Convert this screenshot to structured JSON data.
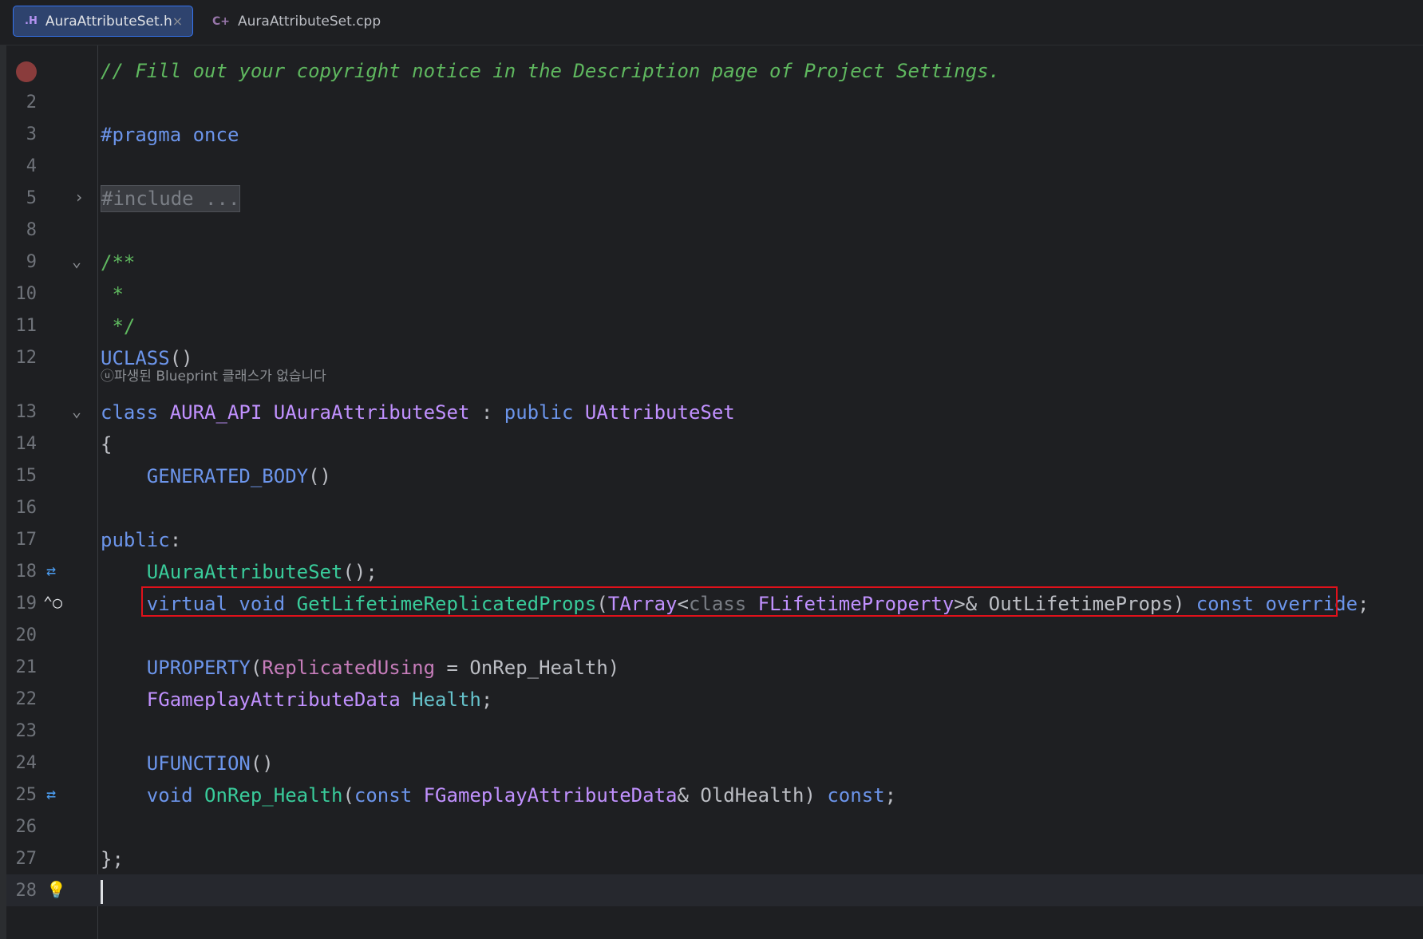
{
  "tabs": [
    {
      "icon": ".H",
      "label": "AuraAttributeSet.h",
      "close": "×"
    },
    {
      "icon": "C+",
      "label": "AuraAttributeSet.cpp"
    }
  ],
  "lines": [
    {
      "n": "",
      "tokens": [
        [
          "cm",
          "// Fill out your copyright notice in the Description page of Project Settings."
        ]
      ]
    },
    {
      "n": "2",
      "tokens": []
    },
    {
      "n": "3",
      "tokens": [
        [
          "kw",
          "#pragma once"
        ]
      ]
    },
    {
      "n": "4",
      "tokens": []
    },
    {
      "n": "5",
      "tokens": [
        [
          "folded",
          "#include ..."
        ]
      ]
    },
    {
      "n": "8",
      "tokens": []
    },
    {
      "n": "9",
      "tokens": [
        [
          "doc",
          "/**"
        ]
      ]
    },
    {
      "n": "10",
      "tokens": [
        [
          "doc",
          " *"
        ]
      ]
    },
    {
      "n": "11",
      "tokens": [
        [
          "doc",
          " */"
        ]
      ]
    },
    {
      "n": "12",
      "tokens": [
        [
          "mac",
          "UCLASS"
        ],
        [
          "plain",
          "()"
        ]
      ]
    },
    {
      "n": "13",
      "tokens": [
        [
          "kw",
          "class "
        ],
        [
          "typ",
          "AURA_API "
        ],
        [
          "typ",
          "UAuraAttributeSet"
        ],
        [
          "plain",
          " : "
        ],
        [
          "kw",
          "public "
        ],
        [
          "typ",
          "UAttributeSet"
        ]
      ]
    },
    {
      "n": "14",
      "tokens": [
        [
          "plain",
          "{"
        ]
      ]
    },
    {
      "n": "15",
      "tokens": [
        [
          "plain",
          "    "
        ],
        [
          "mac",
          "GENERATED_BODY"
        ],
        [
          "plain",
          "()"
        ]
      ]
    },
    {
      "n": "16",
      "tokens": []
    },
    {
      "n": "17",
      "tokens": [
        [
          "kw",
          "public"
        ],
        [
          "plain",
          ":"
        ]
      ]
    },
    {
      "n": "18",
      "tokens": [
        [
          "plain",
          "    "
        ],
        [
          "fn",
          "UAuraAttributeSet"
        ],
        [
          "plain",
          "();"
        ]
      ]
    },
    {
      "n": "19",
      "tokens": [
        [
          "plain",
          "    "
        ],
        [
          "kw",
          "virtual "
        ],
        [
          "kw",
          "void "
        ],
        [
          "fn",
          "GetLifetimeReplicatedProps"
        ],
        [
          "plain",
          "("
        ],
        [
          "typ",
          "TArray"
        ],
        [
          "plain",
          "<"
        ],
        [
          "gray",
          "class "
        ],
        [
          "typ",
          "FLifetimeProperty"
        ],
        [
          "plain",
          ">& "
        ],
        [
          "plain",
          "OutLifetimeProps"
        ],
        [
          "plain",
          ") "
        ],
        [
          "kw",
          "const "
        ],
        [
          "kw",
          "override"
        ],
        [
          "plain",
          ";"
        ]
      ]
    },
    {
      "n": "20",
      "tokens": []
    },
    {
      "n": "21",
      "tokens": [
        [
          "plain",
          "    "
        ],
        [
          "mac",
          "UPROPERTY"
        ],
        [
          "plain",
          "("
        ],
        [
          "ann",
          "ReplicatedUsing"
        ],
        [
          "plain",
          " = OnRep_Health)"
        ]
      ]
    },
    {
      "n": "22",
      "tokens": [
        [
          "plain",
          "    "
        ],
        [
          "typ",
          "FGameplayAttributeData "
        ],
        [
          "prop",
          "Health"
        ],
        [
          "plain",
          ";"
        ]
      ]
    },
    {
      "n": "23",
      "tokens": []
    },
    {
      "n": "24",
      "tokens": [
        [
          "plain",
          "    "
        ],
        [
          "mac",
          "UFUNCTION"
        ],
        [
          "plain",
          "()"
        ]
      ]
    },
    {
      "n": "25",
      "tokens": [
        [
          "plain",
          "    "
        ],
        [
          "kw",
          "void "
        ],
        [
          "fn",
          "OnRep_Health"
        ],
        [
          "plain",
          "("
        ],
        [
          "kw",
          "const "
        ],
        [
          "typ",
          "FGameplayAttributeData"
        ],
        [
          "plain",
          "& "
        ],
        [
          "plain",
          "OldHealth"
        ],
        [
          "plain",
          ") "
        ],
        [
          "kw",
          "const"
        ],
        [
          "plain",
          ";"
        ]
      ]
    },
    {
      "n": "26",
      "tokens": []
    },
    {
      "n": "27",
      "tokens": [
        [
          "plain",
          "};"
        ]
      ]
    },
    {
      "n": "28",
      "tokens": []
    }
  ],
  "hint_text": "ⓤ파생된 Blueprint 클래스가 없습니다"
}
